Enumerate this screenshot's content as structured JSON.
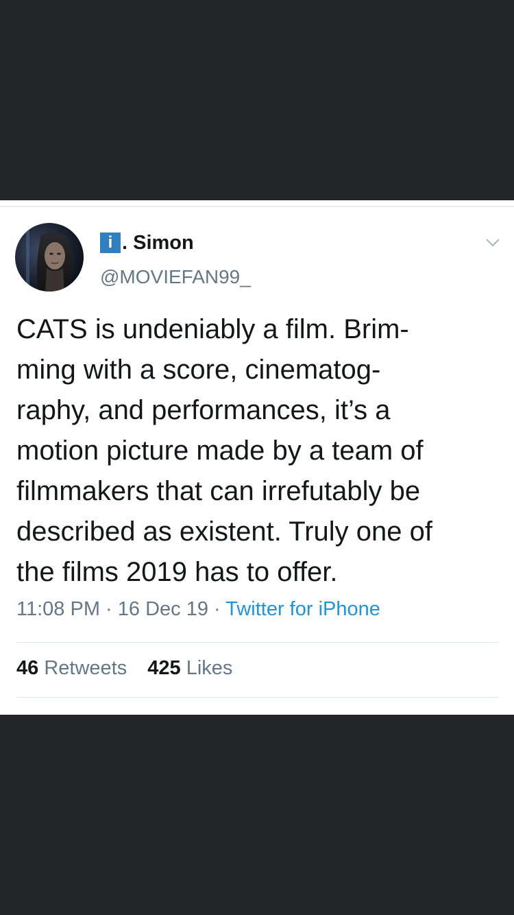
{
  "tweet": {
    "display_name_badge": "i",
    "display_name": ". Simon",
    "handle": "@MOVIEFAN99_",
    "text": "CATS is undeniably a film. Brim-\nming with a score, cinematog-\nraphy, and performances, it’s a\nmotion picture made by a team of\nfilmmakers that can irrefutably be\ndescribed as existent. Truly one of\nthe films 2019 has to offer.",
    "time": "11:08 PM",
    "date": "16 Dec 19",
    "source": "Twitter for iPhone",
    "separator": " · ",
    "retweets_count": "46",
    "retweets_label": "Retweets",
    "likes_count": "425",
    "likes_label": "Likes"
  },
  "icons": {
    "menu": "chevron-down-icon",
    "avatar": "profile-photo"
  },
  "colors": {
    "background": "#242528",
    "card": "#ffffff",
    "text": "#14171a",
    "secondary_text": "#657786",
    "link": "#1b95e0",
    "badge": "#2f7fc1"
  }
}
